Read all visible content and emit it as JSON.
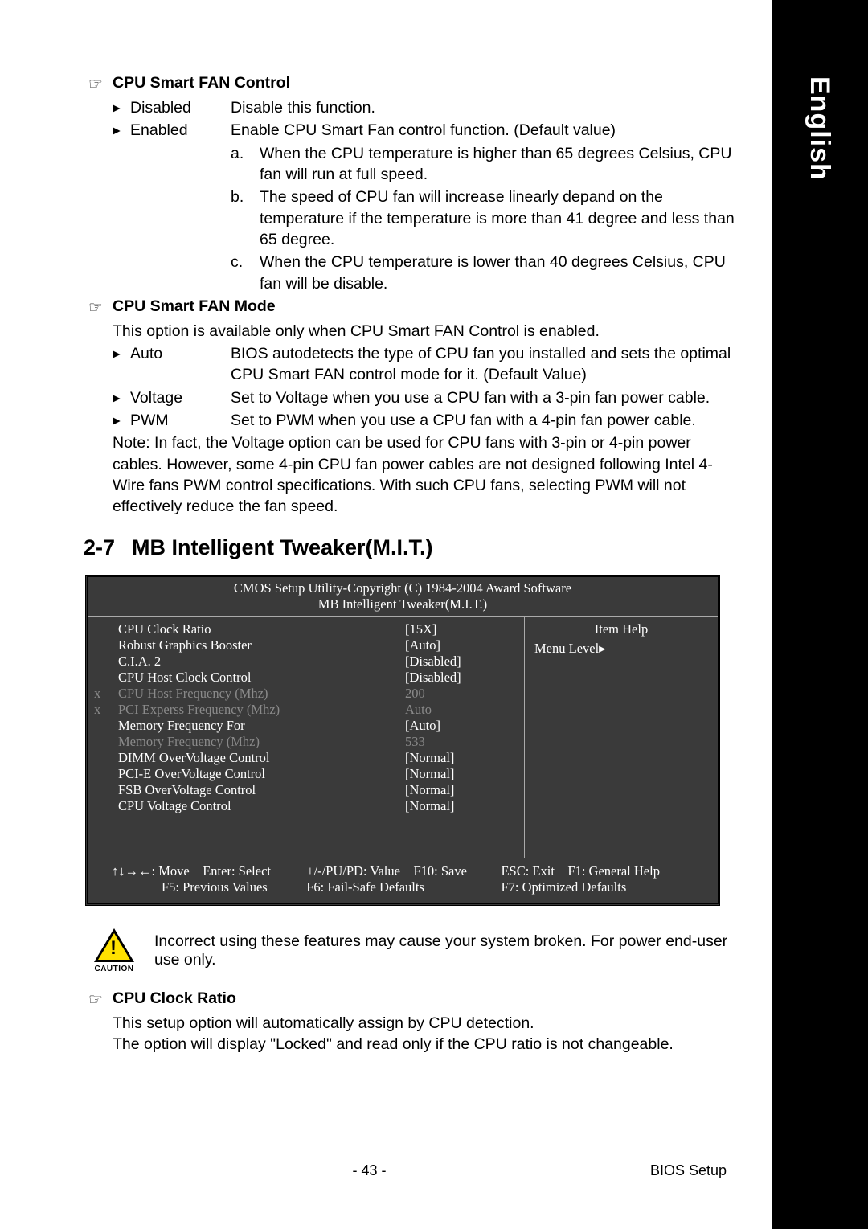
{
  "langTab": "English",
  "sec1": {
    "title": "CPU Smart FAN Control",
    "rows": [
      {
        "label": "Disabled",
        "desc": "Disable this function."
      },
      {
        "label": "Enabled",
        "desc": "Enable CPU Smart Fan control function. (Default value)"
      }
    ],
    "sub": [
      {
        "letter": "a.",
        "text": "When the CPU temperature is higher than 65 degrees Celsius, CPU fan will run at full speed."
      },
      {
        "letter": "b.",
        "text": "The speed of CPU fan will increase linearly depand on the temperature if the temperature is more than 41 degree and less than 65 degree."
      },
      {
        "letter": "c.",
        "text": "When the CPU temperature is lower than 40 degrees Celsius, CPU fan will be disable."
      }
    ]
  },
  "sec2": {
    "title": "CPU Smart FAN Mode",
    "intro": "This option is available only when CPU Smart FAN Control is enabled.",
    "rows": [
      {
        "label": "Auto",
        "desc": "BIOS autodetects the type of CPU fan you installed and sets the optimal CPU Smart FAN control mode for it. (Default Value)"
      },
      {
        "label": "Voltage",
        "desc": "Set to Voltage when you use a CPU fan with a 3-pin fan power cable."
      },
      {
        "label": "PWM",
        "desc": "Set to PWM when you use a CPU fan with a 4-pin fan power cable."
      }
    ],
    "note": "Note: In fact, the Voltage option can be used for CPU fans with 3-pin or 4-pin power cables. However, some 4-pin CPU fan power cables are not designed following Intel 4-Wire fans PWM control specifications. With such CPU fans, selecting PWM will not effectively reduce the fan speed."
  },
  "heading": {
    "num": "2-7",
    "text": "MB Intelligent Tweaker(M.I.T.)"
  },
  "bios": {
    "title": "CMOS Setup Utility-Copyright (C) 1984-2004 Award Software",
    "sub": "MB Intelligent Tweaker(M.I.T.)",
    "itemHelp": "Item Help",
    "menuLevel": "Menu Level▸",
    "rows": [
      {
        "x": "",
        "name": "CPU Clock Ratio",
        "val": "[15X]",
        "dim": false
      },
      {
        "x": "",
        "name": "Robust Graphics Booster",
        "val": "[Auto]",
        "dim": false
      },
      {
        "x": "",
        "name": "C.I.A. 2",
        "val": "[Disabled]",
        "dim": false
      },
      {
        "x": "",
        "name": "CPU Host Clock Control",
        "val": "[Disabled]",
        "dim": false
      },
      {
        "x": "x",
        "name": "CPU Host Frequency (Mhz)",
        "val": "200",
        "dim": true
      },
      {
        "x": "x",
        "name": "PCI Experss Frequency (Mhz)",
        "val": "Auto",
        "dim": true
      },
      {
        "x": "",
        "name": "Memory Frequency For",
        "val": "[Auto]",
        "dim": false
      },
      {
        "x": "",
        "name": "Memory Frequency (Mhz)",
        "val": "533",
        "dim": true
      },
      {
        "x": "",
        "name": "DIMM OverVoltage Control",
        "val": "[Normal]",
        "dim": false
      },
      {
        "x": "",
        "name": "PCI-E OverVoltage Control",
        "val": "[Normal]",
        "dim": false
      },
      {
        "x": "",
        "name": "FSB OverVoltage Control",
        "val": "[Normal]",
        "dim": false
      },
      {
        "x": "",
        "name": "CPU Voltage Control",
        "val": "[Normal]",
        "dim": false
      }
    ],
    "foot": {
      "a": "↑↓→←: Move",
      "b": "Enter: Select",
      "c": "+/-/PU/PD: Value",
      "d": "F10: Save",
      "e": "ESC: Exit",
      "f": "F1: General Help",
      "g": "F5: Previous Values",
      "h": "F6: Fail-Safe Defaults",
      "i": "F7: Optimized Defaults"
    }
  },
  "caution": {
    "label": "CAUTION",
    "text": "Incorrect using these features may cause your system broken. For power end-user use only."
  },
  "sec3": {
    "title": "CPU Clock Ratio",
    "l1": "This setup option will automatically assign by CPU detection.",
    "l2": "The option will display \"Locked\" and read only if the CPU ratio is not changeable."
  },
  "footer": {
    "page": "- 43 -",
    "title": "BIOS Setup"
  }
}
